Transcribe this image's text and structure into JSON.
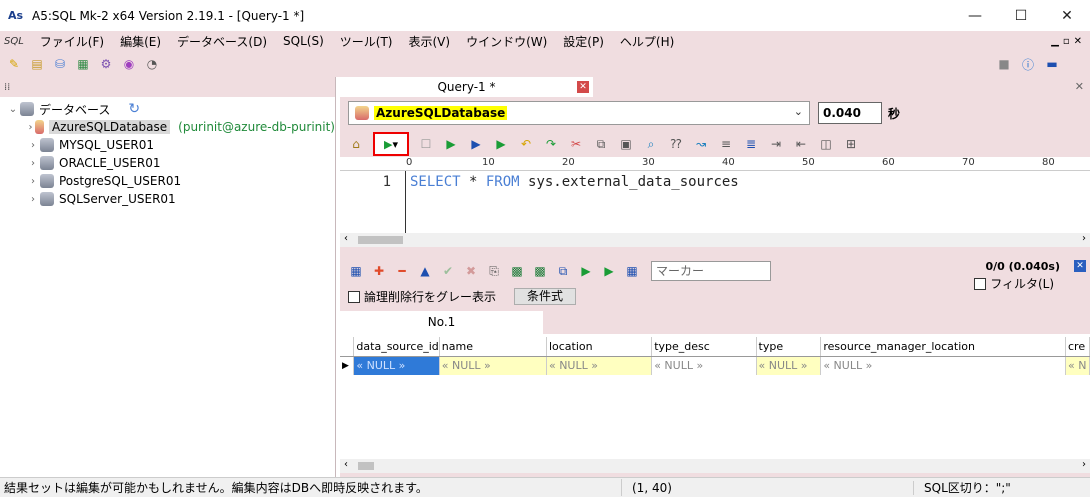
{
  "window": {
    "app_icon_text": "As",
    "title": "A5:SQL Mk-2 x64 Version 2.19.1 - [Query-1 *]",
    "minimize": "—",
    "maximize": "☐",
    "close": "✕"
  },
  "menubar": {
    "sql_icon": "SQL",
    "items": [
      "ファイル(F)",
      "編集(E)",
      "データベース(D)",
      "SQL(S)",
      "ツール(T)",
      "表示(V)",
      "ウインドウ(W)",
      "設定(P)",
      "ヘルプ(H)"
    ],
    "mdi": [
      "▁",
      "▫",
      "✕"
    ]
  },
  "left_panel": {
    "root_label": "データベース",
    "refresh_icon": "↻",
    "items": [
      {
        "label": "AzureSQLDatabase",
        "extra": "(purinit@azure-db-purinit)",
        "selected": true
      },
      {
        "label": "MYSQL_USER01"
      },
      {
        "label": "ORACLE_USER01"
      },
      {
        "label": "PostgreSQL_USER01"
      },
      {
        "label": "SQLServer_USER01"
      }
    ]
  },
  "query": {
    "tab_label": "Query-1 *",
    "connection": "AzureSQLDatabase",
    "elapsed": "0.040",
    "elapsed_unit": "秒",
    "ruler": [
      "0",
      "10",
      "20",
      "30",
      "40",
      "50",
      "60",
      "70",
      "80"
    ],
    "line_number": "1",
    "sql_kw1": "SELECT",
    "sql_star": " * ",
    "sql_kw2": "FROM",
    "sql_rest": " sys.external_data_sources"
  },
  "results": {
    "marker_placeholder": "マーカー",
    "row_status": "0/0 (0.040s)",
    "soft_delete_label": "論理削除行をグレー表示",
    "condition_button": "条件式",
    "filter_label": "フィルタ(L)",
    "tab_label": "No.1",
    "columns": [
      "data_source_id",
      "name",
      "location",
      "type_desc",
      "type",
      "resource_manager_location",
      "cre"
    ],
    "row": [
      "« NULL »",
      "« NULL »",
      "« NULL »",
      "« NULL »",
      "« NULL »",
      "« NULL »",
      "« N"
    ]
  },
  "statusbar": {
    "message": "結果セットは編集が可能かもしれません。編集内容はDBへ即時反映されます。",
    "position": "(1, 40)",
    "delimiter": "SQL区切り：\";\""
  }
}
